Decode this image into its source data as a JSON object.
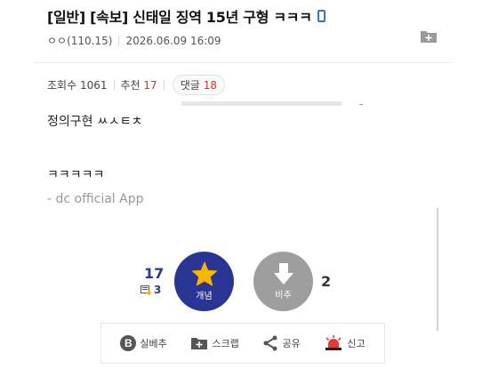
{
  "post": {
    "title": "[일반] [속보] 신태일 징역 15년 구형 ㅋㅋㅋ",
    "author": "ㅇㅇ",
    "ip": "(110.15)",
    "date": "2026.06.09 16:09",
    "views_label": "조회수",
    "views": "1061",
    "recommend_label": "추천",
    "recommend": "17",
    "comment_label": "댓글",
    "comment_count": "18",
    "content_line1": "정의구현 ㅆㅅㅌㅊ",
    "content_line2": "ㅋㅋㅋㅋㅋ",
    "content_line3": "- dc official App"
  },
  "vote": {
    "up_count": "17",
    "fix_count": "3",
    "up_label": "개념",
    "down_label": "비추",
    "down_count": "2"
  },
  "share_bar": {
    "items": [
      {
        "label": "실베추"
      },
      {
        "label": "스크랩"
      },
      {
        "label": "공유"
      },
      {
        "label": "신고"
      }
    ]
  },
  "colors": {
    "up_button": "#283593",
    "down_button": "#9e9e9e",
    "accent_red": "#d4342f",
    "star": "#f5b700",
    "phone_icon": "#3b6fd6",
    "siren": "#e53935"
  },
  "icons": [
    "phone-icon",
    "folder-plus-icon",
    "star-icon",
    "down-arrow-icon",
    "fix-icon",
    "b-icon",
    "scrap-icon",
    "share-icon",
    "siren-icon"
  ]
}
